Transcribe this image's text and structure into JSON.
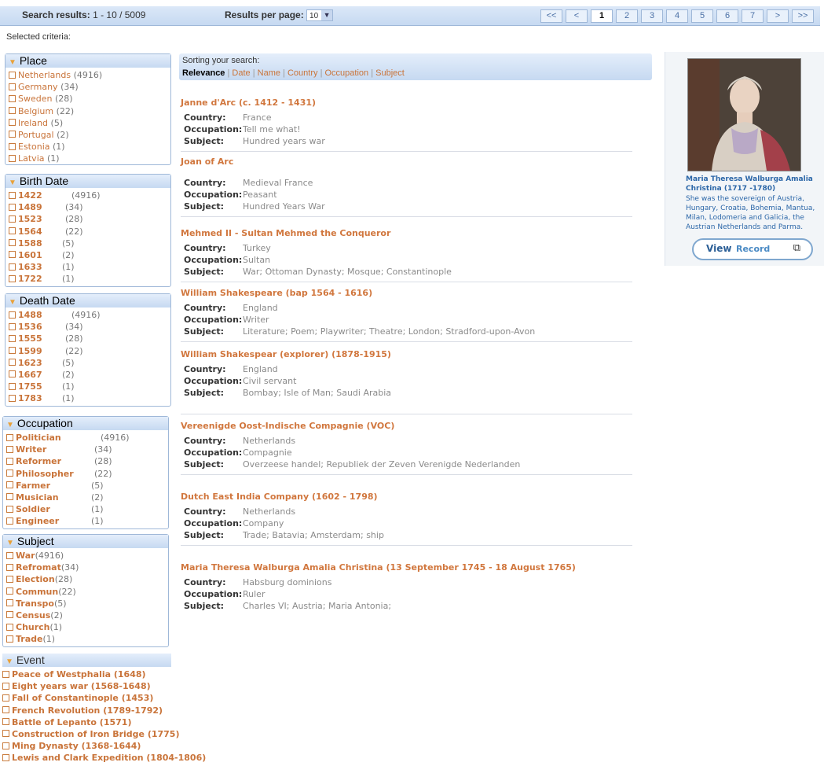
{
  "topbar": {
    "search_results_label": "Search results:",
    "search_results_value": "1 - 10 / 5009",
    "results_per_page_label": "Results per page:",
    "results_per_page_value": "10",
    "pager": [
      "<<",
      "<",
      "1",
      "2",
      "3",
      "4",
      "5",
      "6",
      "7",
      ">",
      ">>"
    ],
    "current_page": "1"
  },
  "selected_criteria": "Selected criteria:",
  "facets": {
    "place": {
      "title": "Place",
      "items": [
        {
          "label": "Netherlands",
          "count": "(4916)"
        },
        {
          "label": "Germany",
          "count": "(34)"
        },
        {
          "label": "Sweden",
          "count": "(28)"
        },
        {
          "label": "Belgium",
          "count": "(22)"
        },
        {
          "label": "Ireland",
          "count": "(5)"
        },
        {
          "label": "Portugal",
          "count": "(2)"
        },
        {
          "label": "Estonia",
          "count": "(1)"
        },
        {
          "label": "Latvia",
          "count": "(1)"
        }
      ]
    },
    "birth_date": {
      "title": "Birth Date",
      "items": [
        {
          "label": "1422",
          "count": "(4916)"
        },
        {
          "label": "1489",
          "count": "(34)"
        },
        {
          "label": "1523",
          "count": "(28)"
        },
        {
          "label": "1564",
          "count": "(22)"
        },
        {
          "label": "1588",
          "count": "(5)"
        },
        {
          "label": "1601",
          "count": "(2)"
        },
        {
          "label": "1633",
          "count": "(1)"
        },
        {
          "label": "1722",
          "count": "(1)"
        }
      ]
    },
    "death_date": {
      "title": "Death Date",
      "items": [
        {
          "label": "1488",
          "count": "(4916)"
        },
        {
          "label": "1536",
          "count": "(34)"
        },
        {
          "label": "1555",
          "count": "(28)"
        },
        {
          "label": "1599",
          "count": "(22)"
        },
        {
          "label": "1623",
          "count": "(5)"
        },
        {
          "label": "1667",
          "count": "(2)"
        },
        {
          "label": "1755",
          "count": "(1)"
        },
        {
          "label": "1783",
          "count": "(1)"
        }
      ]
    },
    "occupation": {
      "title": "Occupation",
      "items": [
        {
          "label": "Politician",
          "count": "(4916)"
        },
        {
          "label": "Writer",
          "count": "(34)"
        },
        {
          "label": "Reformer",
          "count": "(28)"
        },
        {
          "label": "Philosopher",
          "count": "(22)"
        },
        {
          "label": "Farmer",
          "count": "(5)"
        },
        {
          "label": "Musician",
          "count": "(2)"
        },
        {
          "label": "Soldier",
          "count": "(1)"
        },
        {
          "label": "Engineer",
          "count": "(1)"
        }
      ]
    },
    "subject": {
      "title": "Subject",
      "items": [
        {
          "label": "War",
          "count": "(4916)"
        },
        {
          "label": "Refromat",
          "count": "(34)"
        },
        {
          "label": "Election",
          "count": "(28)"
        },
        {
          "label": "Commun",
          "count": "(22)"
        },
        {
          "label": "Transpo",
          "count": "(5)"
        },
        {
          "label": "Census",
          "count": "(2)"
        },
        {
          "label": "Church",
          "count": "(1)"
        },
        {
          "label": "Trade",
          "count": "(1)"
        }
      ]
    },
    "event": {
      "title": "Event",
      "items": [
        "Peace of Westphalia (1648)",
        "Eight years war (1568-1648)",
        "Fall of Constantinople (1453)",
        "French Revolution (1789-1792)",
        "Battle of Lepanto (1571)",
        "Construction of Iron Bridge (1775)",
        "Ming Dynasty (1368-1644)",
        "Lewis and Clark Expedition (1804-1806)"
      ]
    }
  },
  "sorting": {
    "title": "Sorting your search:",
    "active": "Relevance",
    "options": [
      "Date",
      "Name",
      "Country",
      "Occupation",
      "Subject"
    ]
  },
  "field_labels": {
    "country": "Country:",
    "occupation": "Occupation:",
    "subject": "Subject:"
  },
  "results": [
    {
      "title": "Janne d'Arc (c. 1412 - 1431)",
      "country": "France",
      "occupation": "Tell me what!",
      "subject": "Hundred years war"
    },
    {
      "title": "Joan of Arc",
      "country": "Medieval France",
      "occupation": "Peasant",
      "subject": "Hundred Years War"
    },
    {
      "title": "Mehmed II - Sultan Mehmed the Conqueror",
      "country": "Turkey",
      "occupation": "Sultan",
      "subject": "War; Ottoman Dynasty; Mosque; Constantinople"
    },
    {
      "title": "William Shakespeare (bap 1564 - 1616)",
      "country": "England",
      "occupation": "Writer",
      "subject": "Literature; Poem; Playwriter; Theatre; London; Stradford-upon-Avon"
    },
    {
      "title": "William Shakespear (explorer) (1878-1915)",
      "country": "England",
      "occupation": "Civil servant",
      "subject": "Bombay; Isle of Man; Saudi Arabia"
    },
    {
      "title": "Vereenigde Oost-Indische Compagnie (VOC)",
      "country": "Netherlands",
      "occupation": "Compagnie",
      "subject": "Overzeese handel; Republiek der Zeven Verenigde Nederlanden"
    },
    {
      "title": "Dutch East India Company (1602 - 1798)",
      "country": "Netherlands",
      "occupation": "Company",
      "subject": "Trade; Batavia; Amsterdam; ship"
    },
    {
      "title": "Maria Theresa Walburga Amalia Christina (13 September 1745 - 18 August 1765)",
      "country": "Habsburg dominions",
      "occupation": "Ruler",
      "subject": "Charles VI; Austria; Maria Antonia;"
    }
  ],
  "featured": {
    "title": "Maria Theresa Walburga Amalia Christina (1717 -1780)",
    "description": "She was the sovereign of Austria, Hungary, Croatia, Bohemia, Mantua, Milan, Lodomeria and Galicia, the Austrian Netherlands and Parma.",
    "button_view": "View",
    "button_record": "Record",
    "button_icon": "external-window-icon"
  },
  "colors": {
    "accent": "#d1773e",
    "link_blue": "#2c67a8",
    "header_blue": "#c6d9f1"
  }
}
